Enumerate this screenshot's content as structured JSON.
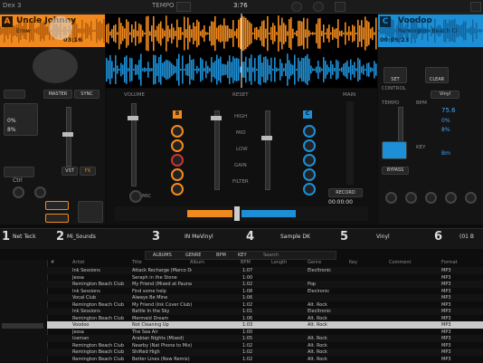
{
  "topbar": {
    "left_label": "Dex 3",
    "center_label": "TEMPO",
    "bpm_readout": "3:76",
    "icons": [
      "sync-icon",
      "gear-icon",
      "record-icon",
      "fullscreen-icon"
    ]
  },
  "deckA": {
    "letter": "A",
    "artist": "Uncle Johnny",
    "title": "Erow",
    "time": "03:16",
    "buttons": {
      "master": "MASTER",
      "sync": "SYNC",
      "vst": "VST",
      "fx": "FX"
    },
    "pitch": "0%",
    "pitch_range": "8%",
    "loop_label": "Ctrl",
    "cue_buttons": [
      "1",
      "2",
      "3",
      "4"
    ]
  },
  "deckC": {
    "letter": "C",
    "artist": "Voodoo",
    "title": "Remington Beach Cl",
    "time": "00:05:23",
    "set_label": "SET",
    "clear_label": "CLEAR",
    "control_label": "CONTROL",
    "vinyl_label": "Vinyl",
    "tempo_label": "TEMPO",
    "bpm_label": "BPM",
    "bpm_value": "75.6",
    "key_label": "KEY",
    "key_value": "Bm",
    "pitch_value": "0%",
    "pitch_range": "8%",
    "bypass_label": "BYPASS"
  },
  "mixer": {
    "volume_label": "VOLUME",
    "reset_label": "RESET",
    "main_label": "MAIN",
    "master_label": "MASTER VOL",
    "high": "HIGH",
    "mid": "MID",
    "low": "LOW",
    "gain": "GAIN",
    "filter": "FILTER",
    "ch_left": "B",
    "ch_right": "C",
    "record_label": "RECORD",
    "time": "00:00:00",
    "mic_label": "MIC"
  },
  "decks": [
    {
      "num": "1",
      "name": "Net Teck"
    },
    {
      "num": "2",
      "name": "Mi_Sounds"
    },
    {
      "num": "3",
      "name": "IN MeVinyl"
    },
    {
      "num": "4",
      "name": "Sample DK"
    },
    {
      "num": "5",
      "name": "Vinyl"
    },
    {
      "num": "6",
      "name": "(01 B"
    }
  ],
  "browser": {
    "tabs": [
      "ALBUMS",
      "GENRE",
      "BPM",
      "KEY"
    ],
    "search_label": "Search",
    "columns": [
      "#",
      "Artist",
      "Title",
      "Album",
      "BPM",
      "Length",
      "Genre",
      "Key",
      "Comment",
      "Format"
    ],
    "rows": [
      [
        "Ink Sessions",
        "Attack Recharge (Marco Dee...",
        "1:07",
        "Elecltronic",
        "MP3"
      ],
      [
        "Jessa",
        "Seraph in the Stone",
        "1:00",
        "",
        "MP3"
      ],
      [
        "Remington Beach Club",
        "My Friend (Mixed at Pauna)",
        "1:02",
        "Pop",
        "MP3"
      ],
      [
        "Ink Sessions",
        "Find some help",
        "1:08",
        "Eleclronic",
        "MP3"
      ],
      [
        "Vocal Club",
        "Always Be Mine",
        "1:06",
        "",
        "MP3"
      ],
      [
        "Remington Beach Club",
        "My Friend (Ink Cover Club)",
        "1:02",
        "Alt. Rock",
        "MP3"
      ],
      [
        "Ink Sessions",
        "Battle In the Sky",
        "1:01",
        "Elecltronic",
        "MP3"
      ],
      [
        "Remington Beach Club",
        "Mermaid Dream",
        "1:06",
        "Alt. Rock",
        "MP3"
      ],
      [
        "Voodoo",
        "Not Cleaning Up",
        "1:03",
        "Alt. Rock",
        "MP3"
      ],
      [
        "Jessa",
        "The Sea Air",
        "1:00",
        "",
        "MP3"
      ],
      [
        "Iceman",
        "Arabian Nights (Mixed)",
        "1:05",
        "Alt. Rock",
        "MP3"
      ],
      [
        "Remington Beach Club",
        "Nearby (Nat Phone to Mix)",
        "1:02",
        "Alt. Rock",
        "MP3"
      ],
      [
        "Remington Beach Club",
        "Shifted High",
        "1:02",
        "Alt. Rock",
        "MP3"
      ],
      [
        "Remington Beach Club",
        "Better Lines (New Remix)",
        "1:02",
        "Alt. Rock",
        "MP3"
      ]
    ]
  },
  "colors": {
    "deckA": "#f08a1e",
    "deckC": "#1d8fd6",
    "bg": "#0c0c0c"
  }
}
